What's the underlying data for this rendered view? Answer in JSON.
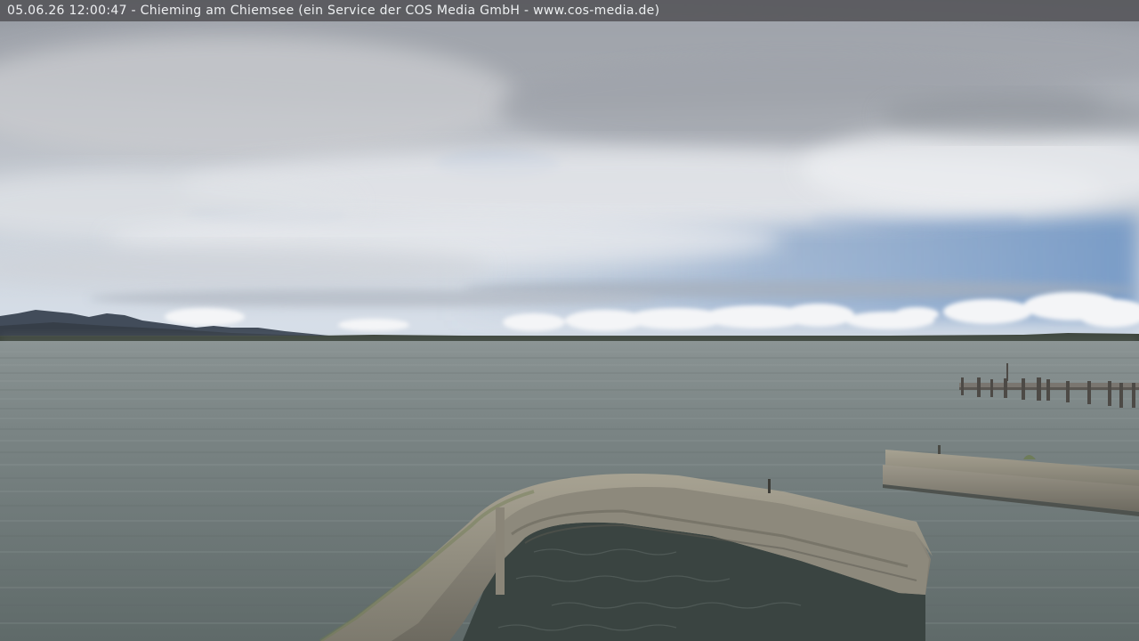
{
  "webcam": {
    "caption": "05.06.26 12:00:47 - Chieming am Chiemsee (ein Service der COS Media GmbH - www.cos-media.de)"
  },
  "palette": {
    "sky_blue": "#6f95c4",
    "cloud": "#e6e8ec",
    "cloud_shadow": "#9ea3ab",
    "lake": "#6e7878",
    "mountains": "#404a58",
    "shore": "#3a4238",
    "pier_stone": "#8f8b7e",
    "harbor_water": "#38423f",
    "caption_bar": "#58585c"
  }
}
